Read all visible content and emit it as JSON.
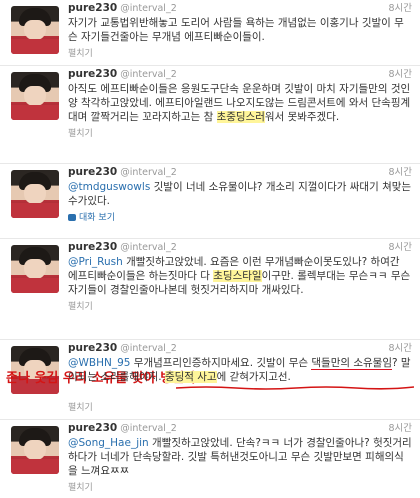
{
  "tweets": [
    {
      "username": "pure230",
      "handle": "@interval_2",
      "time": "8시간",
      "text_pre": "자기가 교통법위반해놓고 도리어 사람들 욕하는 개념없는 이홍기나 깃발이 무슨 자기들건줄아는 무개념 에프티빠순이들이.",
      "action": "펼치기"
    },
    {
      "username": "pure230",
      "handle": "@interval_2",
      "time": "8시간",
      "text_pre": "아직도 에프티빠순이들은 응원도구단속 운운하며 깃발이 마치 자기들만의 것인양 착각하고앉았네. 에프티아일랜드 나오지도않는 드림콘서트에 와서 단속핑계대며 깔짝거리는 꼬라지하고는 참 ",
      "text_hl": "초중딩스러",
      "text_post": "워서 못봐주겠다.",
      "action": "펼치기"
    },
    {
      "username": "pure230",
      "handle": "@interval_2",
      "time": "8시간",
      "mention": "@tmdguswowls",
      "text_pre": " 깃발이 너네 소유물이냐? 개소리 지껄이다가 싸대기 쳐맞는수가있다.",
      "action_icon": "conversation-icon",
      "action": "대화 보기"
    },
    {
      "username": "pure230",
      "handle": "@interval_2",
      "time": "8시간",
      "mention": "@Pri_Rush",
      "text_pre": " 개빨짓하고앉았네. 요즘은 이런 무개념빠순이못도있나? 하여간 에프티빠순이들은 하는짓마다 다 ",
      "text_hl": "초딩스타일",
      "text_mid": "이구만. 롤렉부대는 무슨ㅋㅋ 무슨 자기들이 경찰인줄아나본데 헛짓거리",
      "text_post": "하지마 개싸있다.",
      "action": "펼치기"
    },
    {
      "username": "pure230",
      "handle": "@interval_2",
      "time": "8시간",
      "mention": "@WBHN_95",
      "text_pre": " 무개념프리인증하지마세요. 깃발이 무슨 ",
      "text_ul": "댁들만의 소유물임",
      "text_mid": "? 말이되는 소리를해야지. ",
      "text_hl": "중딩적 사고",
      "text_post": "에 갇혀가지고선.",
      "action": "펼치기"
    },
    {
      "username": "pure230",
      "handle": "@interval_2",
      "time": "8시간",
      "mention": "@Song_Hae_jin",
      "text_pre": " 개빨짓하고앉았네. 단속?ㅋㅋ 너가 경찰인줄아나? 헛짓거리하다가 너네가 단속당할라. 깃발 특허낸것도아니고 무슨 깃발만보면 피해의식을 느껴요ㅉㅉ",
      "action": "펼치기"
    }
  ],
  "annotation": "존나 웃김 우리 소유물 맞아 병신아",
  "colors": {
    "highlight": "#fff59a",
    "annotation": "#d41414",
    "link": "#2a6fae"
  }
}
